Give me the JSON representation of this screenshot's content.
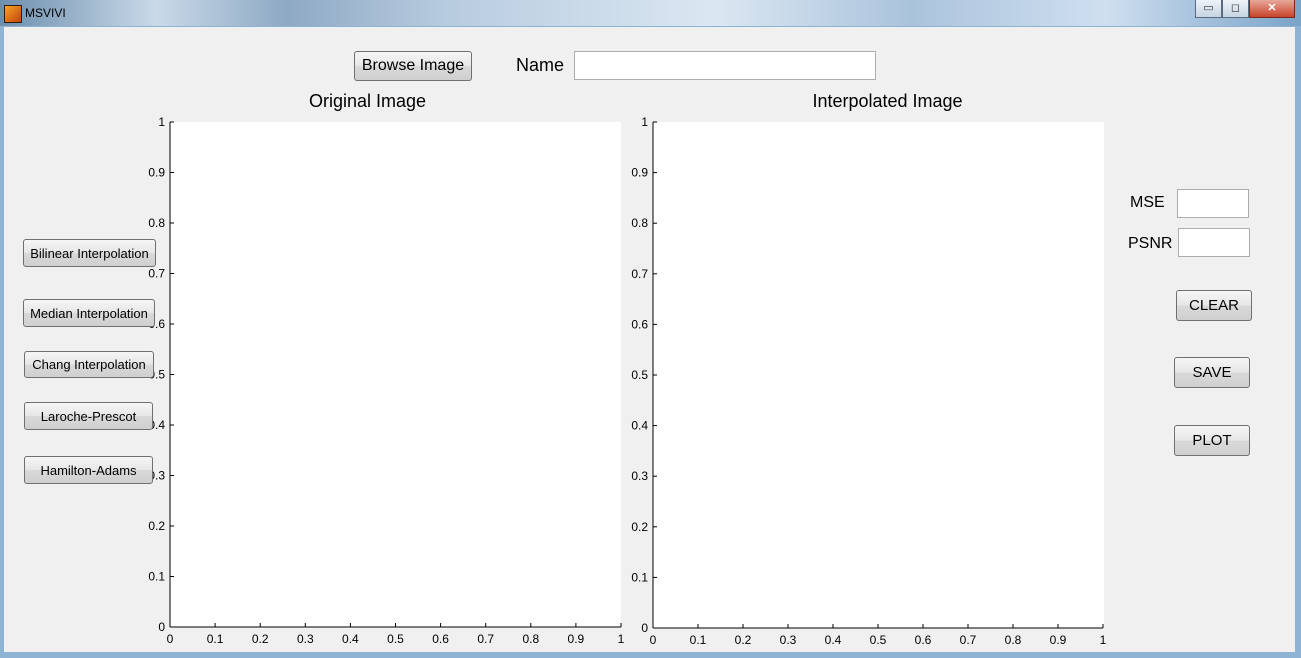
{
  "window": {
    "title": "MSVIVI",
    "minimize_glyph": "▭",
    "maximize_glyph": "◻",
    "close_glyph": "✕",
    "icon": "matlab-icon"
  },
  "top": {
    "browse_label": "Browse Image",
    "name_label": "Name",
    "name_value": ""
  },
  "left_buttons": [
    "Bilinear Interpolation",
    "Median Interpolation",
    "Chang Interpolation",
    "Laroche-Prescot",
    "Hamilton-Adams"
  ],
  "metrics": {
    "mse_label": "MSE",
    "mse_value": "",
    "psnr_label": "PSNR",
    "psnr_value": ""
  },
  "right_buttons": {
    "clear": "CLEAR",
    "save": "SAVE",
    "plot": "PLOT"
  },
  "chart_data": [
    {
      "type": "scatter",
      "title": "Original Image",
      "xlim": [
        0,
        1
      ],
      "ylim": [
        0,
        1
      ],
      "x_ticks": [
        "0",
        "0.1",
        "0.2",
        "0.3",
        "0.4",
        "0.5",
        "0.6",
        "0.7",
        "0.8",
        "0.9",
        "1"
      ],
      "y_ticks": [
        "0",
        "0.1",
        "0.2",
        "0.3",
        "0.4",
        "0.5",
        "0.6",
        "0.7",
        "0.8",
        "0.9",
        "1"
      ],
      "series": []
    },
    {
      "type": "scatter",
      "title": "Interpolated Image",
      "xlim": [
        0,
        1
      ],
      "ylim": [
        0,
        1
      ],
      "x_ticks": [
        "0",
        "0.1",
        "0.2",
        "0.3",
        "0.4",
        "0.5",
        "0.6",
        "0.7",
        "0.8",
        "0.9",
        "1"
      ],
      "y_ticks": [
        "0",
        "0.1",
        "0.2",
        "0.3",
        "0.4",
        "0.5",
        "0.6",
        "0.7",
        "0.8",
        "0.9",
        "1"
      ],
      "series": []
    }
  ]
}
